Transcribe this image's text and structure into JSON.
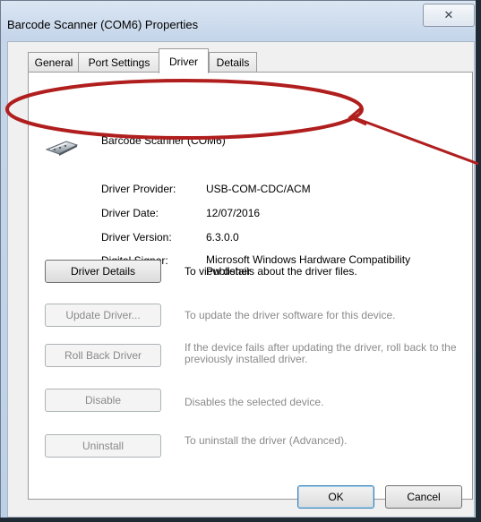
{
  "window": {
    "title": "Barcode Scanner (COM6) Properties",
    "close_glyph": "✕"
  },
  "tabs": [
    {
      "label": "General"
    },
    {
      "label": "Port Settings"
    },
    {
      "label": "Driver",
      "active": true
    },
    {
      "label": "Details"
    }
  ],
  "device": {
    "name": "Barcode Scanner (COM6)",
    "icon": "usb-serial-plug-icon"
  },
  "properties": [
    {
      "label": "Driver Provider:",
      "value": "USB-COM-CDC/ACM"
    },
    {
      "label": "Driver Date:",
      "value": "12/07/2016"
    },
    {
      "label": "Driver Version:",
      "value": "6.3.0.0"
    },
    {
      "label": "Digital Signer:",
      "value": "Microsoft Windows Hardware Compatibility Publisher"
    }
  ],
  "actions": [
    {
      "button": "Driver Details",
      "description": "To view details about the driver files.",
      "enabled": true
    },
    {
      "button": "Update Driver...",
      "description": "To update the driver software for this device.",
      "enabled": false
    },
    {
      "button": "Roll Back Driver",
      "description": "If the device fails after updating the driver, roll back to the previously installed driver.",
      "enabled": false
    },
    {
      "button": "Disable",
      "description": "Disables the selected device.",
      "enabled": false
    },
    {
      "button": "Uninstall",
      "description": "To uninstall the driver (Advanced).",
      "enabled": false
    }
  ],
  "footer": {
    "ok_label": "OK",
    "cancel_label": "Cancel"
  },
  "annotation": {
    "color": "#b01e1e"
  }
}
